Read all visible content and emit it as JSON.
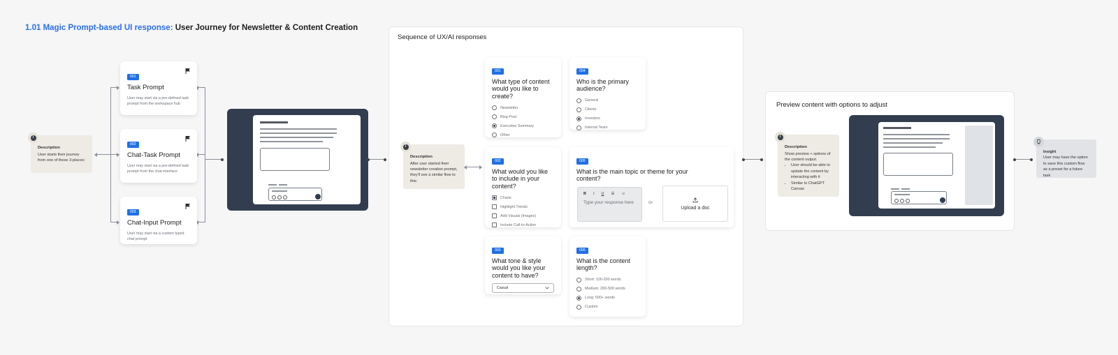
{
  "title": {
    "prefix": "1.01 Magic Prompt-based UI response:",
    "text": "User Journey for Newsletter & Content Creation"
  },
  "left_description": {
    "heading": "Description",
    "text": "User starts their journey from one of these 3-places:",
    "badge": "i"
  },
  "prompts": [
    {
      "tag": "001",
      "title": "Task Prompt",
      "desc": "User may start via a pre-defined task prompt from the workspace hub"
    },
    {
      "tag": "002",
      "title": "Chat-Task Prompt",
      "desc": "User may start via a pre-defined task prompt from the chat interface"
    },
    {
      "tag": "003",
      "title": "Chat-Input Prompt",
      "desc": "User may start via a custom typed chat prompt"
    }
  ],
  "sequence": {
    "title": "Sequence of UX/AI responses",
    "description": {
      "heading": "Description",
      "text": "After user started their newsletter creation prompt, they'll see a similar flow to this:",
      "badge": "i"
    },
    "q1": {
      "tag": "001",
      "title": "What type of content would you like to create?",
      "options": [
        "Newsletter",
        "Blog Post",
        "Executive Summary",
        "Other"
      ],
      "selected": 2
    },
    "q2": {
      "tag": "002",
      "title": "What would you like to include in your content?",
      "options": [
        "Charts",
        "Highlight Trends",
        "Add Visuals (Images)",
        "Include Call-to-Action"
      ],
      "selected": 0
    },
    "q3": {
      "tag": "003",
      "title": "What tone & style would you like your content to have?",
      "select_value": "Casual"
    },
    "q4": {
      "tag": "004",
      "title": "Who is the primary audience?",
      "options": [
        "General",
        "Clients",
        "Investors",
        "Internal Team"
      ],
      "selected": 2
    },
    "q5": {
      "tag": "005",
      "title": "What is the main topic or theme for your content?",
      "tools": [
        "B",
        "I",
        "U",
        "☰",
        "☺"
      ],
      "placeholder": "Type your response here",
      "or": "Or",
      "upload": "Upload a doc"
    },
    "q6": {
      "tag": "006",
      "title": "What is the content length?",
      "options": [
        "Short: 100-200 words",
        "Medium: 200-500 words",
        "Long: 500+ words",
        "Custom"
      ],
      "selected": 2
    }
  },
  "preview": {
    "title": "Preview content with options to adjust",
    "description": {
      "heading": "Description",
      "intro": "Show preview + options of the content output.",
      "bullets": [
        "User should be able to update the content by interacting with it",
        "Similar to ChatGPT Canvas"
      ],
      "badge": "i"
    }
  },
  "insight": {
    "heading": "Insight",
    "text": "User may have the option to save this custom flow as a preset for a future task"
  },
  "icons": {
    "flag": "flag-icon",
    "upload": "upload-icon",
    "chevron": "chevron-down-icon",
    "bulb": "lightbulb-icon"
  },
  "colors": {
    "accent": "#2a6ef0",
    "tag": "#1f6fe5",
    "mock_bg": "#323e4f",
    "description_bg": "#eeebe4",
    "insight_bg": "#e1e3e6"
  }
}
